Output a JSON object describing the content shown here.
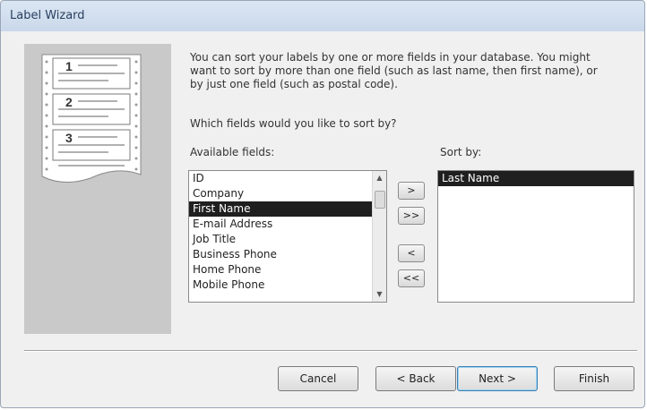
{
  "window": {
    "title": "Label Wizard"
  },
  "text": {
    "intro": "You can sort your labels by one or more fields in your database. You might want to sort by more than one field (such as last name, then first name), or by just one field (such as postal code).",
    "question": "Which fields would you like to sort by?",
    "available_label": "Available fields:",
    "sortby_label": "Sort by:"
  },
  "illustration": {
    "numbers": [
      "1",
      "2",
      "3"
    ]
  },
  "available_fields": {
    "items": [
      "ID",
      "Company",
      "First Name",
      "E-mail Address",
      "Job Title",
      "Business Phone",
      "Home Phone",
      "Mobile Phone"
    ],
    "selected": "First Name"
  },
  "sort_by": {
    "items": [
      "Last Name"
    ],
    "selected": "Last Name"
  },
  "move_buttons": {
    "add": ">",
    "add_all": ">>",
    "remove": "<",
    "remove_all": "<<"
  },
  "buttons": {
    "cancel": "Cancel",
    "back": "< Back",
    "next": "Next >",
    "finish": "Finish"
  },
  "colors": {
    "selection": "#1f1f1f",
    "panel": "#c9c9c9",
    "dialog_bg": "#f0f0f0"
  }
}
